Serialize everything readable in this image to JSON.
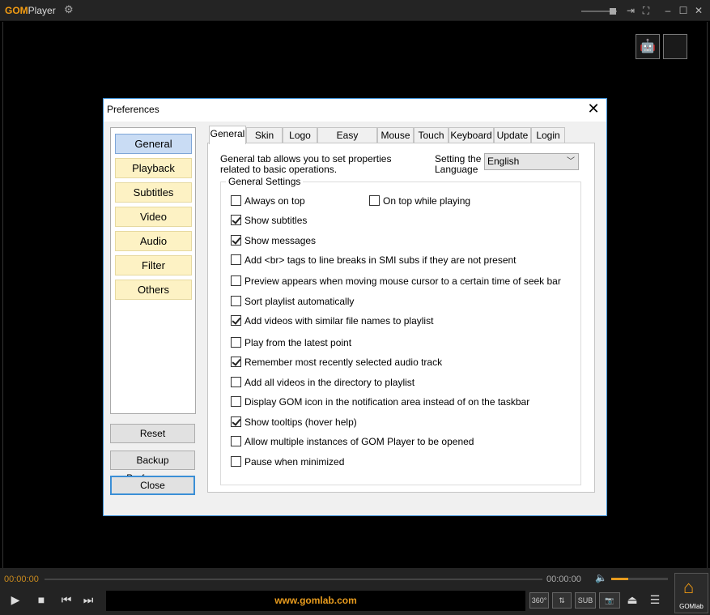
{
  "player": {
    "logo_gom": "GOM",
    "logo_player": "Player",
    "website": "www.gomlab.com",
    "time_elapsed": "00:00:00",
    "time_total": "00:00:00",
    "volume_fraction": 0.3,
    "gomlab_label": "GOMlab",
    "sub_label": "SUB",
    "vr_label": "360°"
  },
  "dialog": {
    "title": "Preferences",
    "categories": [
      "General",
      "Playback",
      "Subtitles",
      "Video",
      "Audio",
      "Filter",
      "Others"
    ],
    "active_category": "General",
    "buttons": {
      "reset": "Reset",
      "backup": "Backup Preferences",
      "close": "Close"
    },
    "tabs": [
      "General",
      "Skin",
      "Logo",
      "Easy Browser",
      "Mouse",
      "Touch",
      "Keyboard",
      "Update",
      "Login"
    ],
    "active_tab": "General",
    "description": "General tab allows you to set properties related to basic operations.",
    "language_label": "Setting the Language",
    "language_value": "English",
    "group_title": "General Settings",
    "options": [
      {
        "label": "Always on top",
        "checked": false
      },
      {
        "label": "On top while playing",
        "checked": false
      },
      {
        "label": "Show subtitles",
        "checked": true
      },
      {
        "label": "Show messages",
        "checked": true
      },
      {
        "label": "Add <br> tags to line breaks in SMI subs if they are not present",
        "checked": false
      },
      {
        "label": "Preview appears when moving mouse cursor to a certain time of seek bar",
        "checked": false
      },
      {
        "label": "Sort playlist automatically",
        "checked": false
      },
      {
        "label": "Add videos with similar file names to playlist",
        "checked": true
      },
      {
        "label": "Play from the latest point",
        "checked": false
      },
      {
        "label": "Remember most recently selected audio track",
        "checked": true
      },
      {
        "label": "Add all videos in the directory to playlist",
        "checked": false
      },
      {
        "label": "Display GOM icon in the notification area instead of on the taskbar",
        "checked": false
      },
      {
        "label": "Show tooltips (hover help)",
        "checked": true
      },
      {
        "label": "Allow multiple instances of GOM Player to be opened",
        "checked": false
      },
      {
        "label": "Pause when minimized",
        "checked": false
      }
    ]
  }
}
